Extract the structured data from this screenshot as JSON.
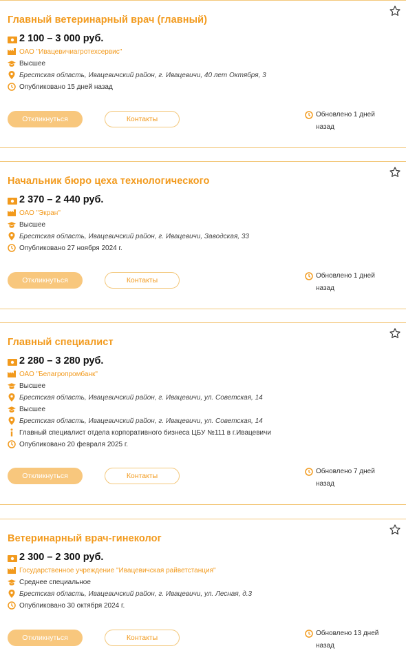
{
  "colors": {
    "accent": "#f29a1d",
    "button_fill": "#f8c77d",
    "border": "#f3c77a"
  },
  "labels": {
    "respond": "Откликнуться",
    "contacts": "Контакты"
  },
  "icons": {
    "salary": "banknote-icon",
    "company": "factory-icon",
    "education": "graduation-cap-icon",
    "address": "location-pin-icon",
    "info": "info-icon",
    "published": "clock-icon",
    "updated": "clock-icon",
    "favorite": "star-outline-icon"
  },
  "vacancies": [
    {
      "title": "Главный ветеринарный врач (главный)",
      "salary": "2 100 – 3 000 руб.",
      "details": [
        {
          "kind": "company",
          "text": "ОАО \"Ивацевичиагротехсервис\""
        },
        {
          "kind": "education",
          "text": "Высшее"
        },
        {
          "kind": "address",
          "text": "Брестская область, Ивацевичский район, г. Ивацевичи, 40 лет Октября, 3"
        },
        {
          "kind": "published",
          "text": "Опубликовано 15 дней назад"
        }
      ],
      "updated": "Обновлено 1 дней назад"
    },
    {
      "title": "Начальник бюро цеха технологического",
      "salary": "2 370 – 2 440 руб.",
      "details": [
        {
          "kind": "company",
          "text": "ОАО \"Экран\""
        },
        {
          "kind": "education",
          "text": "Высшее"
        },
        {
          "kind": "address",
          "text": "Брестская область, Ивацевичский район, г. Ивацевичи, Заводская, 33"
        },
        {
          "kind": "published",
          "text": "Опубликовано 27 ноября 2024 г."
        }
      ],
      "updated": "Обновлено 1 дней назад"
    },
    {
      "title": "Главный специалист",
      "salary": "2 280 – 3 280 руб.",
      "details": [
        {
          "kind": "company",
          "text": "ОАО \"Белагропромбанк\""
        },
        {
          "kind": "education",
          "text": "Высшее"
        },
        {
          "kind": "address",
          "text": "Брестская область, Ивацевичский район, г. Ивацевичи, ул. Советская, 14"
        },
        {
          "kind": "education",
          "text": "Высшее"
        },
        {
          "kind": "address",
          "text": "Брестская область, Ивацевичский район, г. Ивацевичи, ул. Советская, 14"
        },
        {
          "kind": "info",
          "text": "Главный специалист отдела корпоративного бизнеса ЦБУ №111 в г.Ивацевичи"
        },
        {
          "kind": "published",
          "text": "Опубликовано 20 февраля 2025 г."
        }
      ],
      "updated": "Обновлено 7 дней назад"
    },
    {
      "title": "Ветеринарный врач-гинеколог",
      "salary": "2 300 – 2 300 руб.",
      "details": [
        {
          "kind": "company",
          "text": "Государственное учреждение \"Ивацевичская райветстанция\""
        },
        {
          "kind": "education",
          "text": "Среднее специальное"
        },
        {
          "kind": "address",
          "text": "Брестская область, Ивацевичский район, г. Ивацевичи, ул. Лесная, д.3"
        },
        {
          "kind": "published",
          "text": "Опубликовано 30 октября 2024 г."
        }
      ],
      "updated": "Обновлено 13 дней назад"
    }
  ]
}
